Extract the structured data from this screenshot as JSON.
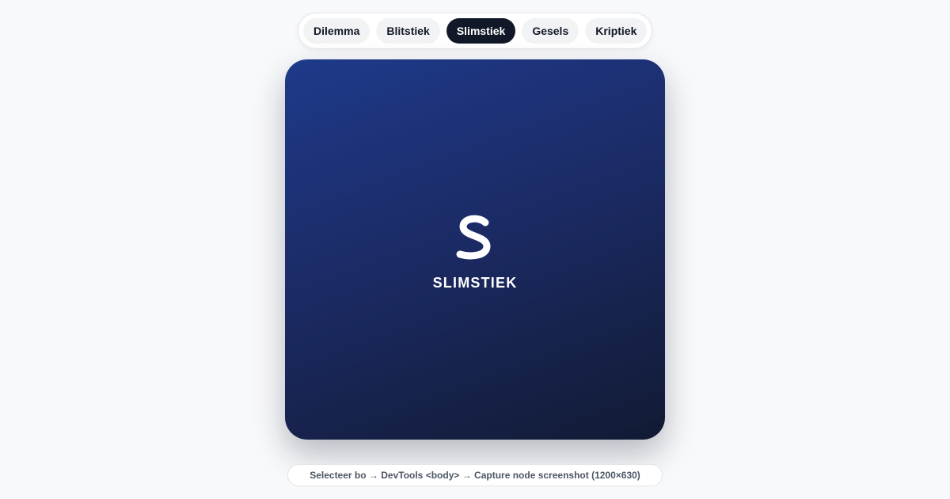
{
  "tabs": [
    {
      "label": "Dilemma",
      "active": false
    },
    {
      "label": "Blitstiek",
      "active": false
    },
    {
      "label": "Slimstiek",
      "active": true
    },
    {
      "label": "Gesels",
      "active": false
    },
    {
      "label": "Kriptiek",
      "active": false
    }
  ],
  "card": {
    "logo_icon": "s-logo-icon",
    "brand": "SLIMSTIEK",
    "gradient": [
      "#1e3a8a",
      "#121a33"
    ]
  },
  "hint": {
    "text": "Selecteer bo → DevTools <body> → Capture node screenshot (1200×630)"
  },
  "colors": {
    "background": "#f8f9fb",
    "tab_active_bg": "#111827",
    "tab_inactive_bg": "#f1f3f5"
  }
}
